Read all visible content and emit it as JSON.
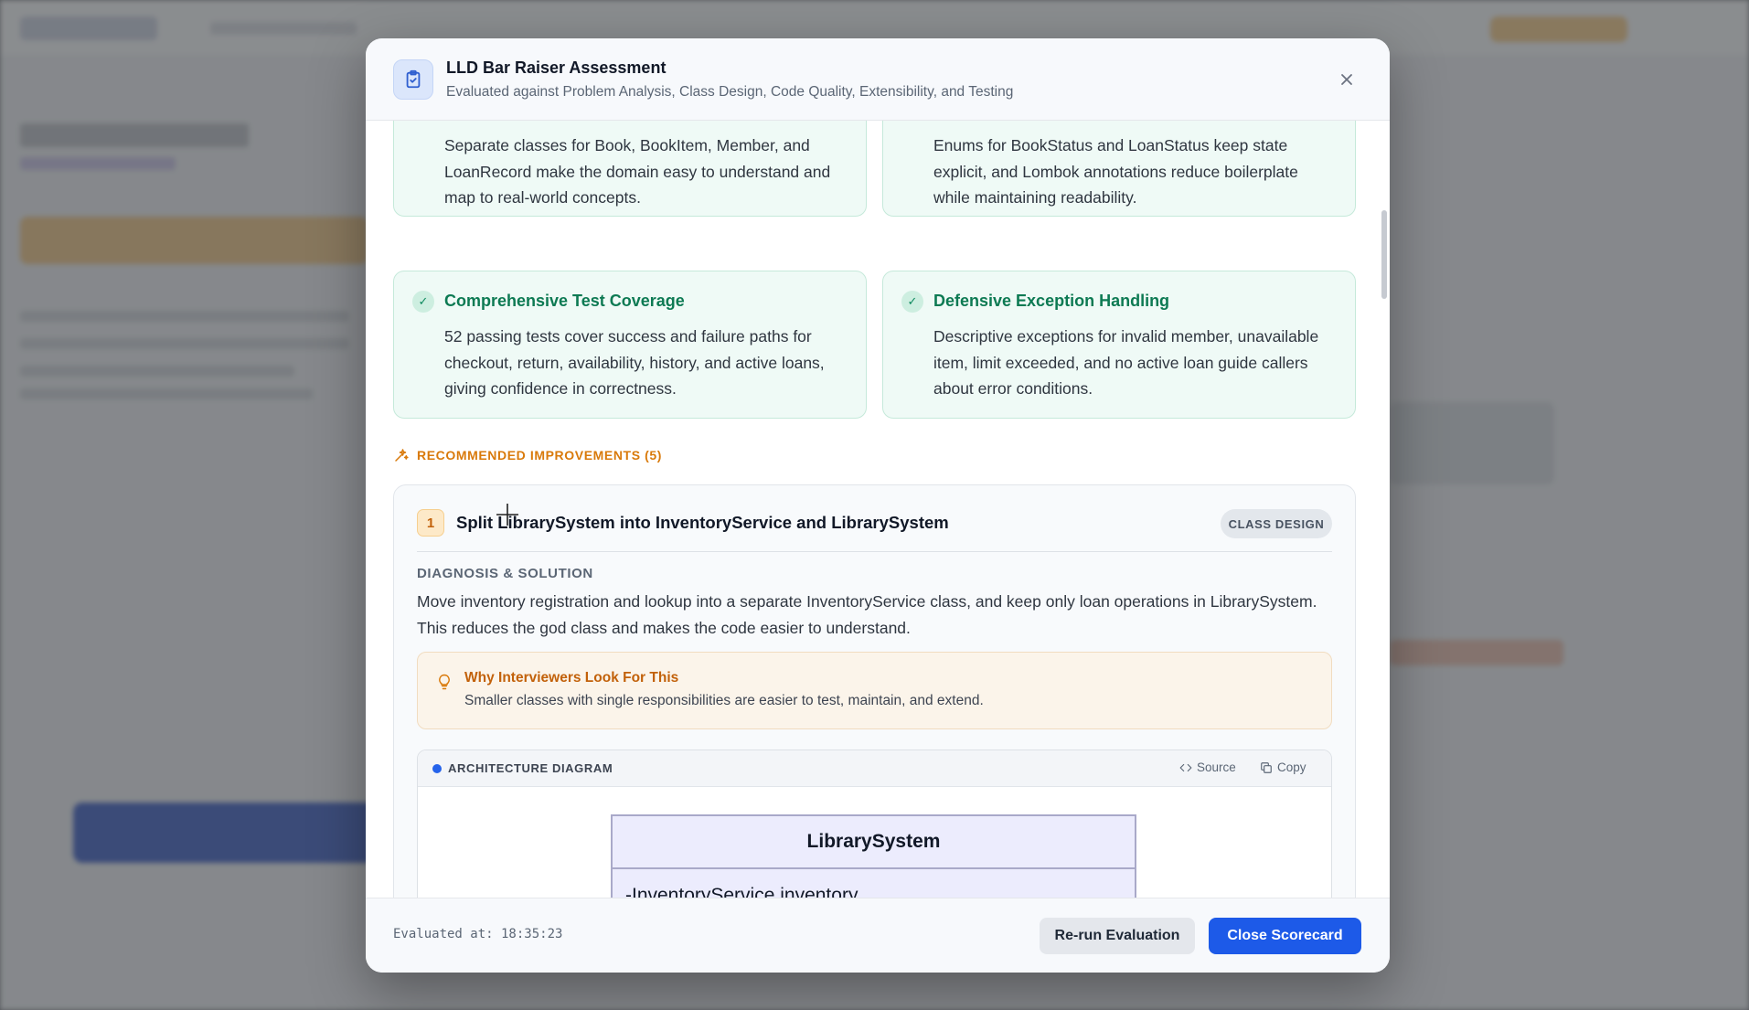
{
  "modal": {
    "title": "LLD Bar Raiser Assessment",
    "subtitle": "Evaluated against Problem Analysis, Class Design, Code Quality, Extensibility, and Testing",
    "icon": "clipboard-check-icon",
    "close_icon": "close-icon"
  },
  "strengths": [
    {
      "title": "",
      "description": "Separate classes for Book, BookItem, Member, and LoanRecord make the domain easy to understand and map to real-world concepts."
    },
    {
      "title": "",
      "description": "Enums for BookStatus and LoanStatus keep state explicit, and Lombok annotations reduce boilerplate while maintaining readability."
    },
    {
      "title": "Comprehensive Test Coverage",
      "description": "52 passing tests cover success and failure paths for checkout, return, availability, history, and active loans, giving confidence in correctness."
    },
    {
      "title": "Defensive Exception Handling",
      "description": "Descriptive exceptions for invalid member, unavailable item, limit exceeded, and no active loan guide callers about error conditions."
    }
  ],
  "check_glyph": "✓",
  "improvements": {
    "label": "RECOMMENDED IMPROVEMENTS (5)",
    "items": [
      {
        "number": "1",
        "title": "Split LibrarySystem into InventoryService and LibrarySystem",
        "tag": "CLASS DESIGN",
        "diagnosis_label": "DIAGNOSIS & SOLUTION",
        "diagnosis": "Move inventory registration and lookup into a separate InventoryService class, and keep only loan operations in LibrarySystem. This reduces the god class and makes the code easier to understand.",
        "why_title": "Why Interviewers Look For This",
        "why_text": "Smaller classes with single responsibilities are easier to test, maintain, and extend.",
        "diagram": {
          "label": "ARCHITECTURE DIAGRAM",
          "source_label": "Source",
          "copy_label": "Copy",
          "class_name": "LibrarySystem",
          "attributes": [
            "-InventoryService inventory"
          ]
        }
      }
    ]
  },
  "footer": {
    "evaluated_at": "Evaluated at: 18:35:23",
    "rerun_label": "Re-run Evaluation",
    "close_label": "Close Scorecard"
  },
  "colors": {
    "primary": "#1d5ae8",
    "success": "#0d7a53",
    "warning": "#d97a0b"
  }
}
